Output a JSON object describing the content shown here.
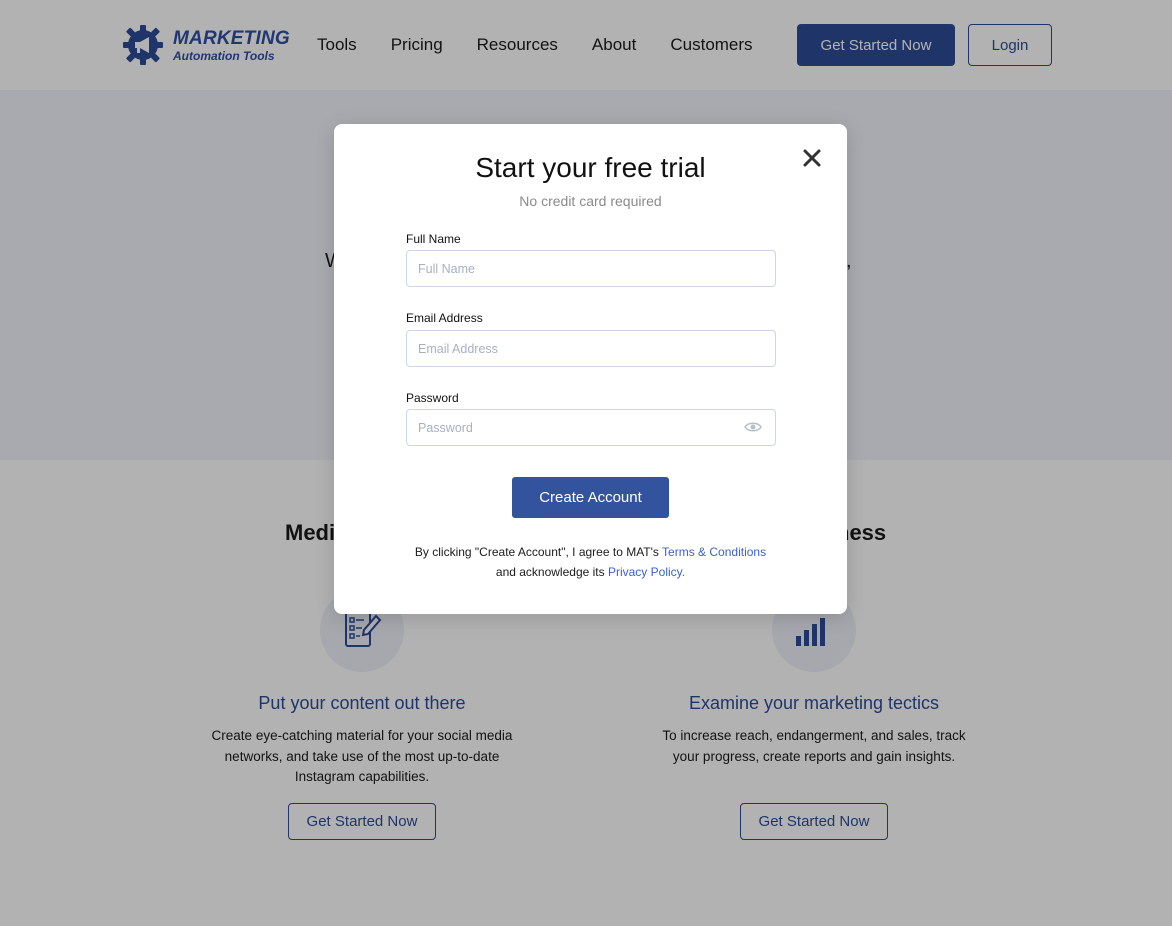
{
  "header": {
    "logo_title": "MARKETING",
    "logo_subtitle": "Automation Tools",
    "nav": [
      "Tools",
      "Pricing",
      "Resources",
      "About",
      "Customers"
    ],
    "cta_label": "Get Started Now",
    "login_label": "Login"
  },
  "hero": {
    "left_fragment": "W",
    "right_fragment": ","
  },
  "section": {
    "title_left_fragment": "Medi",
    "title_right_fragment": "ness",
    "features": [
      {
        "icon": "checklist-icon",
        "title": "Put your content out there",
        "description": "Create eye-catching material for your social media networks, and take use of the most up-to-date Instagram capabilities.",
        "button_label": "Get Started Now"
      },
      {
        "icon": "bar-chart-icon",
        "title": "Examine your marketing tectics",
        "description": "To increase reach, endangerment, and sales, track your progress, create reports and gain insights.",
        "button_label": "Get Started Now"
      }
    ]
  },
  "modal": {
    "title": "Start your free trial",
    "subtitle": "No credit card required",
    "full_name_label": "Full Name",
    "full_name_placeholder": "Full Name",
    "email_label": "Email Address",
    "email_placeholder": "Email Address",
    "password_label": "Password",
    "password_placeholder": "Password",
    "submit_label": "Create Account",
    "legal_prefix": "By clicking \"Create Account\", I agree to MAT's ",
    "terms_link": "Terms & Conditions",
    "legal_middle": "and acknowledge its ",
    "privacy_link": "Privacy Policy."
  },
  "colors": {
    "brand": "#2d4c99",
    "link": "#3a62c9",
    "overlay": "rgba(0,0,0,0.30)"
  }
}
